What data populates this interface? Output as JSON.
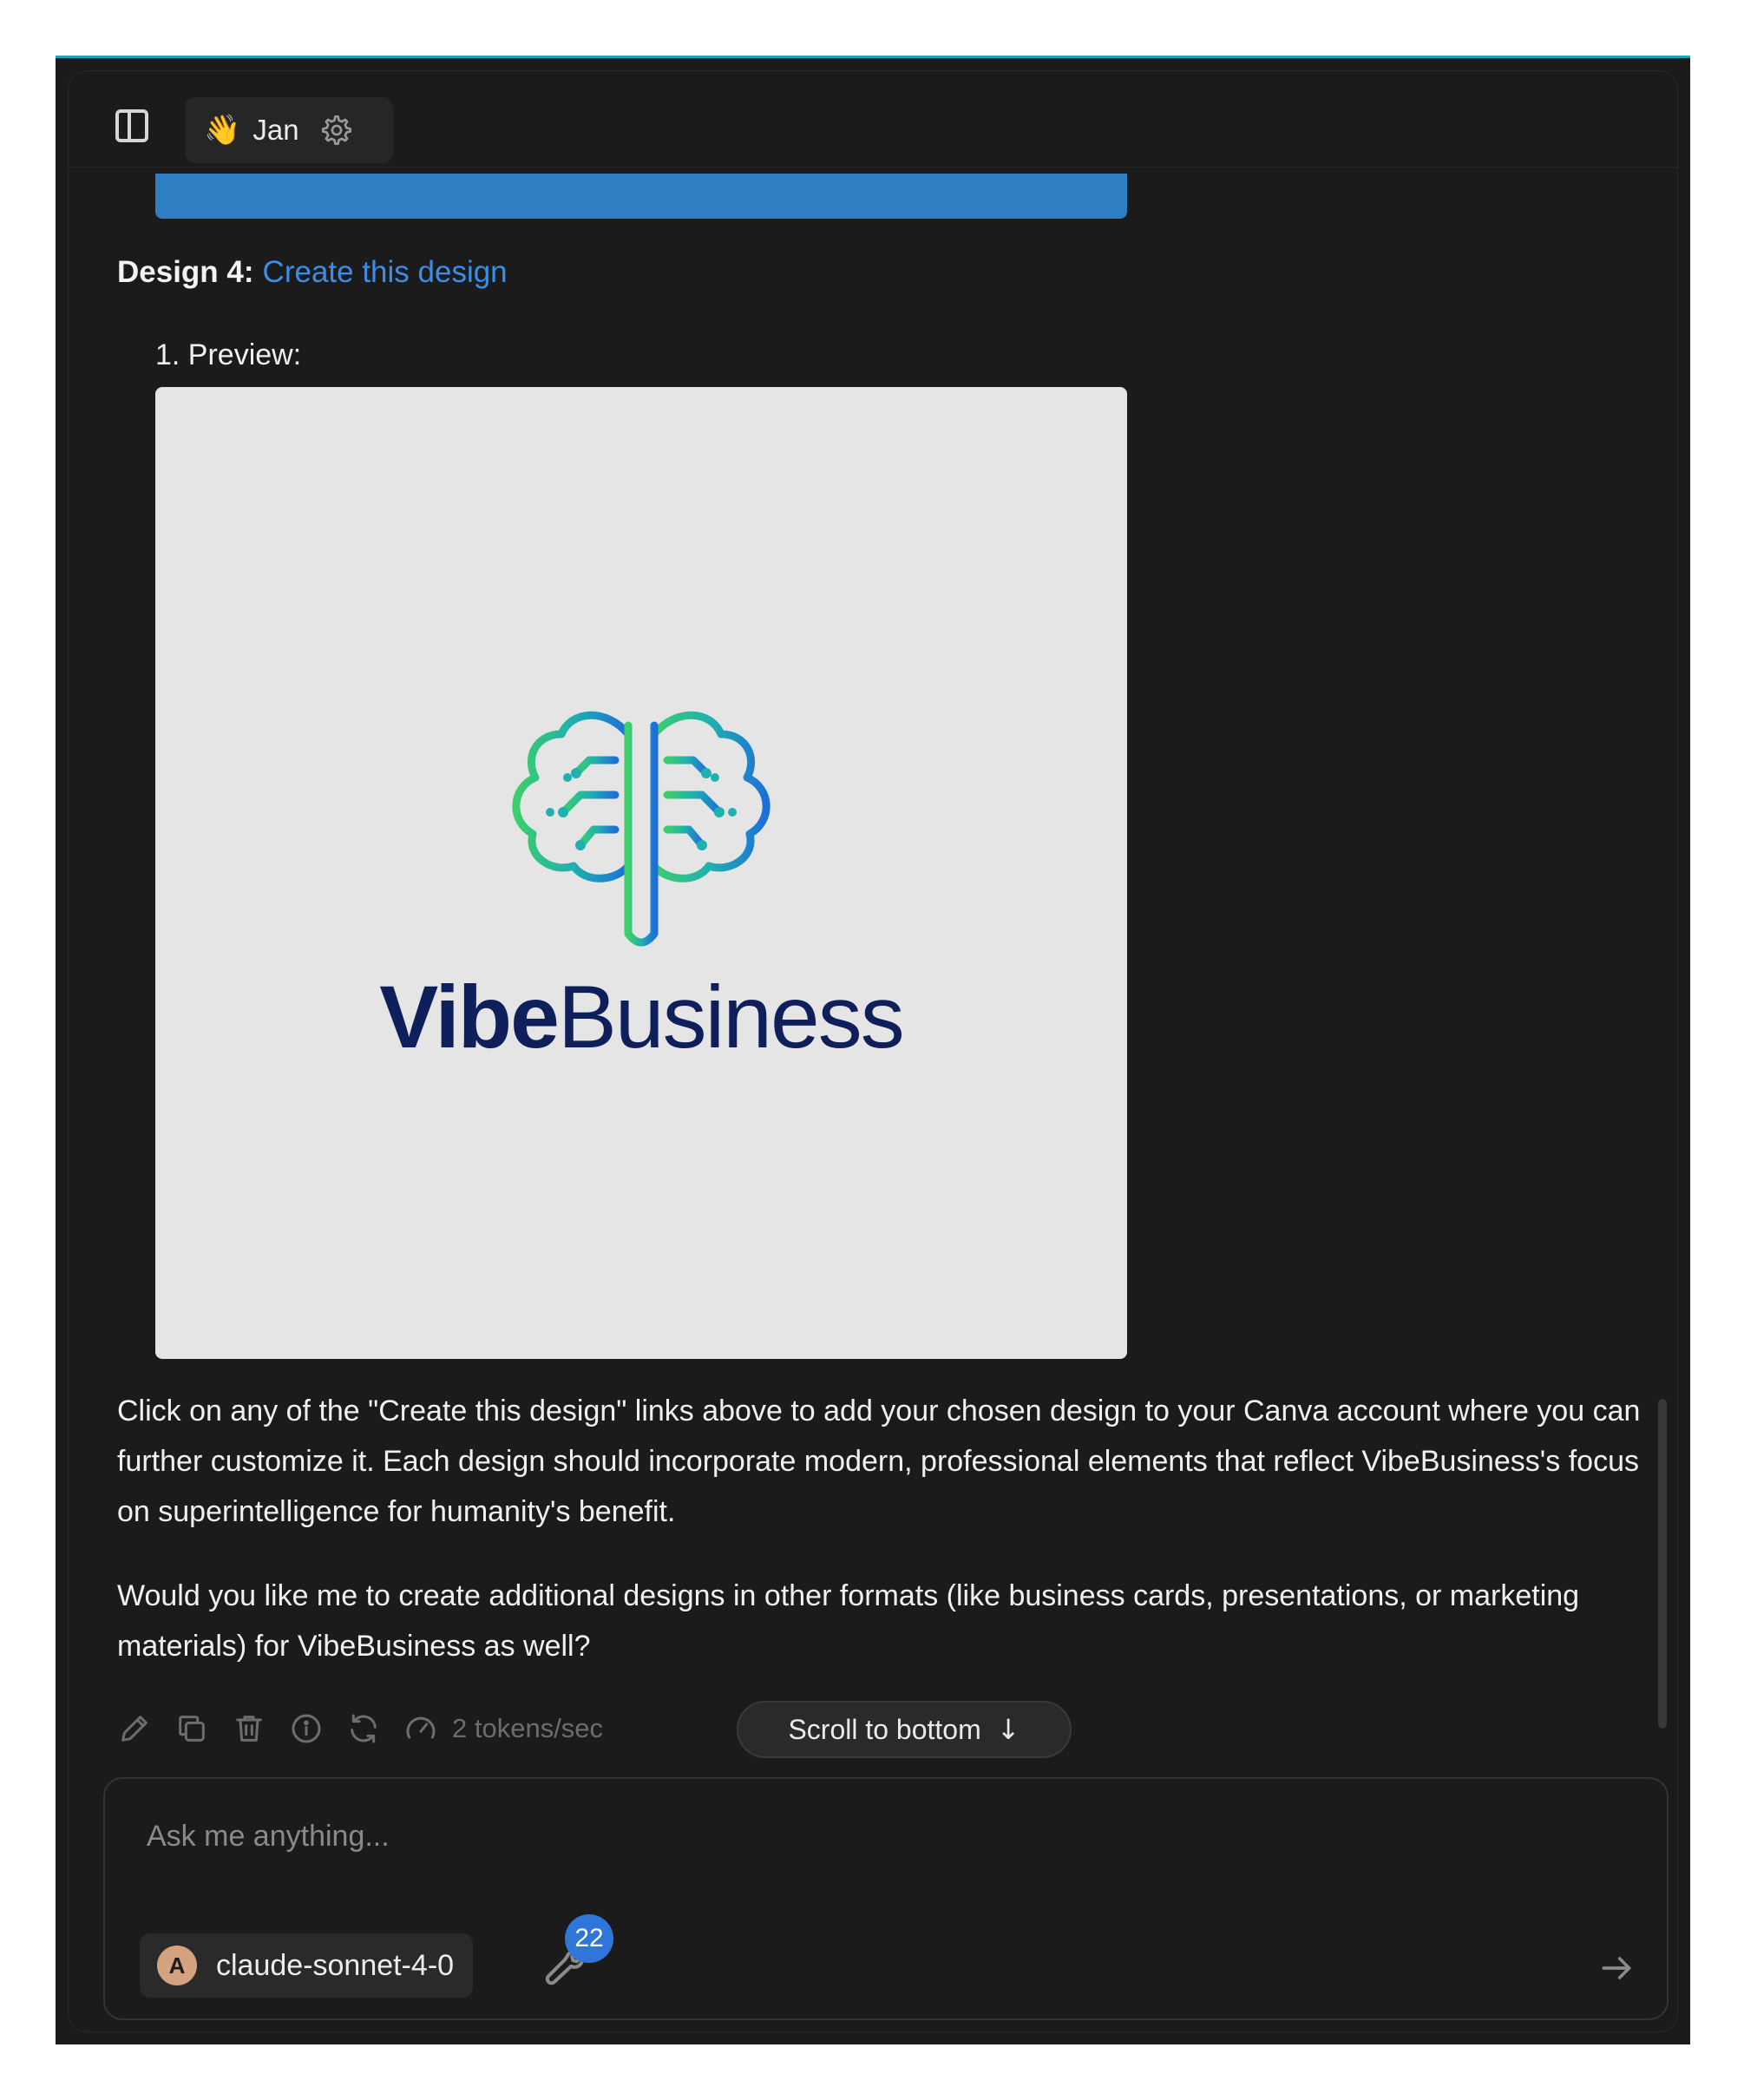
{
  "header": {
    "assistant_emoji": "👋",
    "assistant_name": "Jan"
  },
  "message": {
    "design_label": "Design 4:",
    "design_link": "Create this design",
    "preview_label": "1. Preview:",
    "logo_text_bold": "Vibe",
    "logo_text_regular": "Business",
    "paragraph_1": "Click on any of the \"Create this design\" links above to add your chosen design to your Canva account where you can further customize it. Each design should incorporate modern, professional elements that reflect VibeBusiness's focus on superintelligence for humanity's benefit.",
    "paragraph_2": "Would you like me to create additional designs in other formats (like business cards, presentations, or marketing materials) for VibeBusiness as well?",
    "tokens_speed": "2 tokens/sec"
  },
  "scroll_to_bottom": {
    "label": "Scroll to bottom",
    "arrow": "↓"
  },
  "composer": {
    "placeholder": "Ask me anything...",
    "model_name": "claude-sonnet-4-0",
    "tools_count": "22"
  },
  "colors": {
    "background": "#1b1b1b",
    "link": "#3a8ee6",
    "badge": "#2f76d8",
    "logo_text": "#0f1f5c",
    "preview_bg": "#e5e5e5"
  },
  "icons": [
    "sidebar-toggle-icon",
    "gear-icon",
    "pencil-icon",
    "copy-icon",
    "trash-icon",
    "info-icon",
    "regenerate-icon",
    "speedometer-icon",
    "wrench-icon",
    "arrow-right-icon"
  ]
}
